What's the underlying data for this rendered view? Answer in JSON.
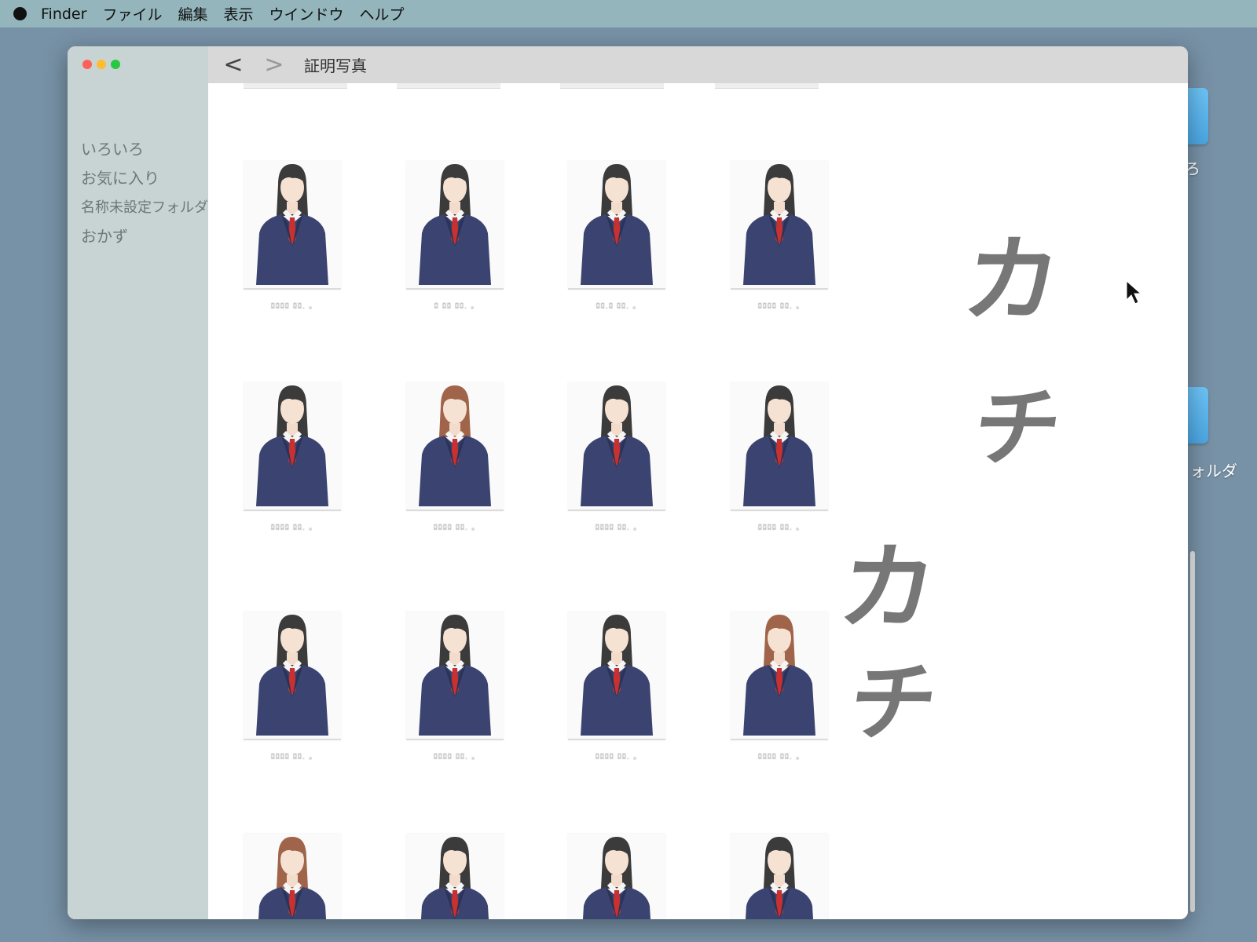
{
  "menubar": {
    "items": [
      "Finder",
      "ファイル",
      "編集",
      "表示",
      "ウインドウ",
      "ヘルプ"
    ]
  },
  "desktop": {
    "folders": [
      {
        "label": "ろ"
      },
      {
        "label": "ォルダ"
      }
    ]
  },
  "window": {
    "title": "証明写真",
    "back_label": "<",
    "forward_label": ">"
  },
  "sidebar": {
    "items": [
      {
        "label": "いろいろ"
      },
      {
        "label": "お気に入り"
      },
      {
        "label": "名称未設定フォルダ"
      },
      {
        "label": "おかず"
      }
    ]
  },
  "files": {
    "row1": [
      {
        "hair": "#3b3b3b",
        "label": "ﾛﾛﾛﾛ  ﾛﾛ. ｡"
      },
      {
        "hair": "#3b3b3b",
        "label": "ﾛ ﾛﾛ  ﾛﾛ. ｡"
      },
      {
        "hair": "#3b3b3b",
        "label": "ﾛﾛ.ﾛ  ﾛﾛ. ｡"
      },
      {
        "hair": "#3b3b3b",
        "label": "ﾛﾛﾛﾛ  ﾛﾛ. ｡"
      }
    ],
    "row2": [
      {
        "hair": "#3b3b3b",
        "label": "ﾛﾛﾛﾛ  ﾛﾛ. ｡"
      },
      {
        "hair": "#a0644a",
        "label": "ﾛﾛﾛﾛ  ﾛﾛ. ｡"
      },
      {
        "hair": "#3b3b3b",
        "label": "ﾛﾛﾛﾛ  ﾛﾛ. ｡"
      },
      {
        "hair": "#3b3b3b",
        "label": "ﾛﾛﾛﾛ  ﾛﾛ. ｡"
      }
    ],
    "row3": [
      {
        "hair": "#3b3b3b",
        "label": "ﾛﾛﾛﾛ  ﾛﾛ. ｡"
      },
      {
        "hair": "#3b3b3b",
        "label": "ﾛﾛﾛﾛ  ﾛﾛ. ｡"
      },
      {
        "hair": "#3b3b3b",
        "label": "ﾛﾛﾛﾛ  ﾛﾛ. ｡"
      },
      {
        "hair": "#a0644a",
        "label": "ﾛﾛﾛﾛ  ﾛﾛ. ｡"
      }
    ],
    "row4": [
      {
        "hair": "#a0644a",
        "label": ""
      },
      {
        "hair": "#3b3b3b",
        "label": ""
      },
      {
        "hair": "#3b3b3b",
        "label": ""
      },
      {
        "hair": "#3b3b3b",
        "label": ""
      }
    ]
  },
  "sound_effects": [
    {
      "text": "カ"
    },
    {
      "text": "チ"
    },
    {
      "text": "カ"
    },
    {
      "text": "チ"
    }
  ],
  "colors": {
    "desktop": "#7791a6",
    "menubar": "#93b5bb",
    "sidebar": "#c8d4d4",
    "suit": "#3b4470",
    "tie": "#c8312f"
  }
}
